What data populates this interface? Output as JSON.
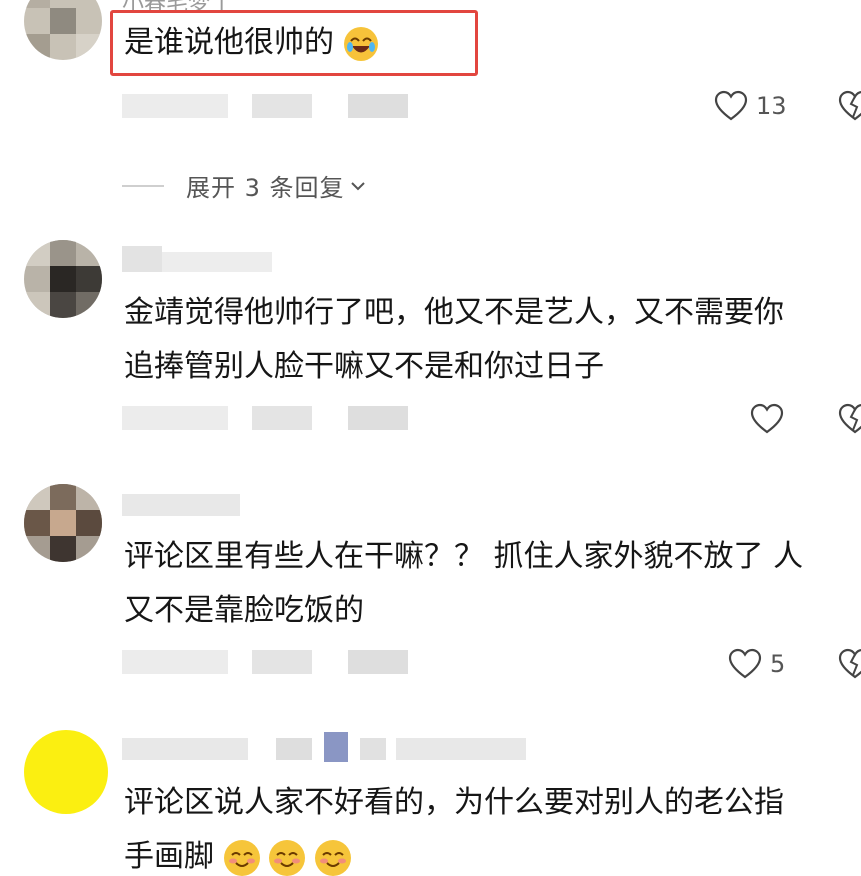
{
  "comments": [
    {
      "username": "小春毛梦丁",
      "text": "是谁说他很帅的",
      "likes": "13",
      "expand_label": "展开 3 条回复"
    },
    {
      "text_line1": "金靖觉得他帅行了吧，他又不是艺人，又不需要你",
      "text_line2": "追捧管别人脸干嘛又不是和你过日子"
    },
    {
      "text_line1": "评论区里有些人在干嘛？？ 抓住人家外貌不放了 人",
      "text_line2": "又不是靠脸吃饭的",
      "likes": "5"
    },
    {
      "text_line1": "评论区说人家不好看的，为什么要对别人的老公指",
      "text_line2": "手画脚"
    }
  ],
  "icons": {
    "like": "heart-outline-icon",
    "dislike": "broken-heart-icon",
    "expand": "chevron-down-icon",
    "emoji": "smiling-face-emoji"
  },
  "colors": {
    "highlight": "#e2463f",
    "text": "#161616",
    "meta": "#555555"
  }
}
